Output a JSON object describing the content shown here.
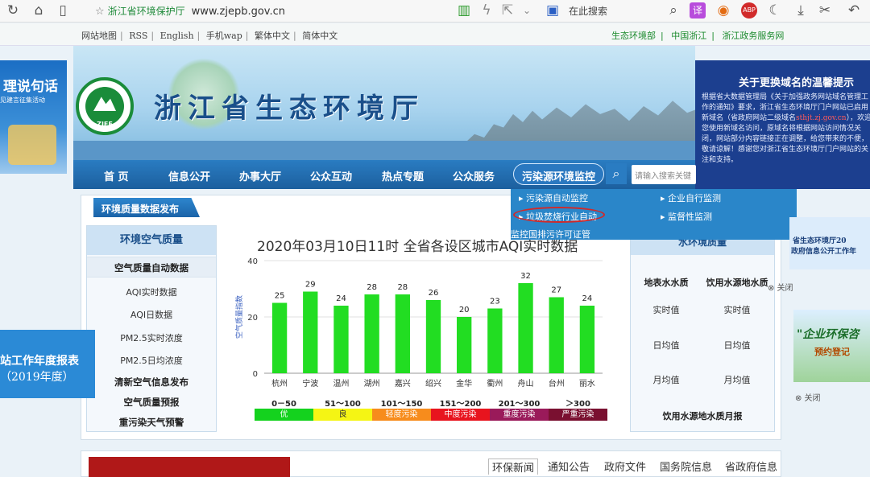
{
  "browser": {
    "tab_title": "浙江省环境保护厅",
    "url": "www.zjepb.gov.cn",
    "search_placeholder": "在此搜索"
  },
  "topbar": {
    "links": [
      "网站地图",
      "RSS",
      "English",
      "手机wap",
      "繁体中文",
      "简体中文"
    ],
    "right_links": [
      "生态环境部",
      "|",
      "中国浙江",
      "|",
      "浙江政务服务网"
    ]
  },
  "header": {
    "logo_text": "ZJEE",
    "site_title": "浙江省生态环境厅"
  },
  "nav": {
    "items": [
      "首 页",
      "信息公开",
      "办事大厅",
      "公众互动",
      "热点专题",
      "公众服务",
      "污染源环境监控"
    ],
    "search_placeholder": "请输入搜索关键"
  },
  "dropdown": {
    "items": [
      "污染源自动监控",
      "企业自行监测",
      "垃圾焚烧行业自动",
      "监督性监测",
      "监控国排污许可证管"
    ]
  },
  "section": {
    "tab_label": "环境质量数据发布"
  },
  "left_menu": {
    "header": "环境空气质量",
    "items": [
      "空气质量自动数据",
      "AQI实时数据",
      "AQI日数据",
      "PM2.5实时浓度",
      "PM2.5日均浓度",
      "清新空气信息发布",
      "空气质量预报",
      "重污染天气预警"
    ]
  },
  "chart_data": {
    "type": "bar",
    "title": "2020年03月10日11时 全省各设区城市AQI实时数据",
    "ylabel": "空气质量指数",
    "ylim": [
      0,
      40
    ],
    "yticks": [
      0,
      20,
      40
    ],
    "categories": [
      "杭州",
      "宁波",
      "温州",
      "湖州",
      "嘉兴",
      "绍兴",
      "金华",
      "衢州",
      "舟山",
      "台州",
      "丽水"
    ],
    "values": [
      25,
      29,
      24,
      28,
      28,
      26,
      20,
      23,
      32,
      27,
      24
    ],
    "bar_color": "#22dd22",
    "legend": [
      {
        "range": "0－50",
        "label": "优",
        "color": "#14d21e"
      },
      {
        "range": "51～100",
        "label": "良",
        "color": "#f5f514"
      },
      {
        "range": "101～150",
        "label": "轻度污染",
        "color": "#f78c1c"
      },
      {
        "range": "151～200",
        "label": "中度污染",
        "color": "#e8141e"
      },
      {
        "range": "201～300",
        "label": "重度污染",
        "color": "#9a1a5a"
      },
      {
        "range": "＞300",
        "label": "严重污染",
        "color": "#7a1030"
      }
    ]
  },
  "right_panel": {
    "header": "水环境质量",
    "col1": "地表水水质",
    "col2": "饮用水源地水质",
    "rows": [
      [
        "实时值",
        "实时值"
      ],
      [
        "日均值",
        "日均值"
      ],
      [
        "月均值",
        "月均值"
      ]
    ],
    "footer": "饮用水源地水质月报"
  },
  "notice": {
    "title": "关于更换域名的温馨提示",
    "body_1": "根据省大数据管理局《关于加强政务网站域名管理工作的通知》要求，浙江省生态环境厅门户网站已启用新域名（省政府网站二级域名",
    "body_red": "sthjt.zj.gov.cn",
    "body_2": "），欢迎您使用新域名访问，原域名将根据网站访问情况关闭，网站部分内容链接正在调整，给您带来的不便，敬请谅解！感谢您对浙江省生态环境厅门户网站的关注和支持。"
  },
  "ads": {
    "left_title": "理说句话",
    "left_sub": "见建言征集活动",
    "left2_line1": "站工作年度报表",
    "left2_line2": "（2019年度）",
    "right1_line1": "省生态环境厅20",
    "right1_line2": "政府信息公开工作年",
    "right2_title": "\"企业环保咨",
    "right2_sub": "预约登记",
    "close": "⊗ 关闭"
  },
  "news": {
    "tabs": [
      "环保新闻",
      "通知公告",
      "政府文件",
      "国务院信息",
      "省政府信息"
    ]
  }
}
